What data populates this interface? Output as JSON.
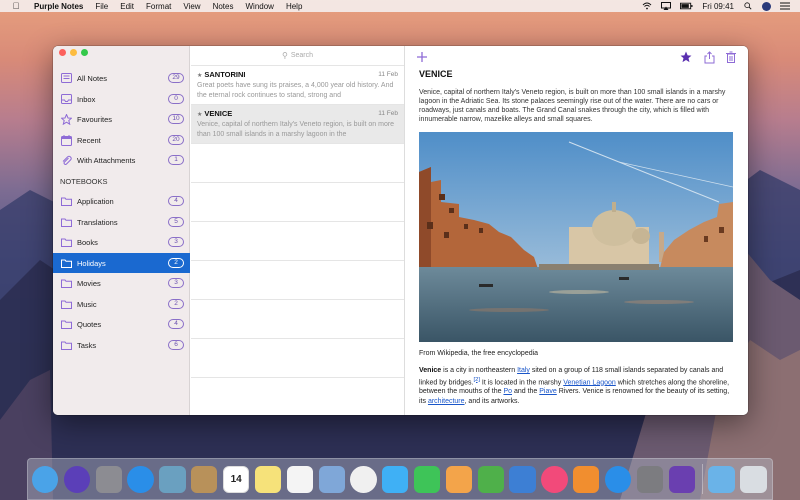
{
  "menubar": {
    "app_name": "Purple Notes",
    "items": [
      "File",
      "Edit",
      "Format",
      "View",
      "Notes",
      "Window",
      "Help"
    ],
    "clock": "Fri 09:41"
  },
  "sidebar": {
    "items": [
      {
        "label": "All Notes",
        "count": "29",
        "icon": "notes-icon"
      },
      {
        "label": "Inbox",
        "count": "0",
        "icon": "inbox-icon"
      },
      {
        "label": "Favourites",
        "count": "10",
        "icon": "star-icon"
      },
      {
        "label": "Recent",
        "count": "20",
        "icon": "calendar-icon"
      },
      {
        "label": "With Attachments",
        "count": "1",
        "icon": "paperclip-icon"
      }
    ],
    "notebooks_header": "NOTEBOOKS",
    "notebooks": [
      {
        "label": "Application",
        "count": "4"
      },
      {
        "label": "Translations",
        "count": "5"
      },
      {
        "label": "Books",
        "count": "3"
      },
      {
        "label": "Holidays",
        "count": "2",
        "selected": true
      },
      {
        "label": "Movies",
        "count": "3"
      },
      {
        "label": "Music",
        "count": "2"
      },
      {
        "label": "Quotes",
        "count": "4"
      },
      {
        "label": "Tasks",
        "count": "6"
      }
    ]
  },
  "list": {
    "search_placeholder": "Search",
    "notes": [
      {
        "title": "SANTORINI",
        "date": "11 Feb",
        "preview": "Great poets have sung its praises, a 4,000 year old history. And the eternal rock continues to stand, strong and"
      },
      {
        "title": "VENICE",
        "date": "11 Feb",
        "preview": "Venice, capital of northern Italy's Veneto region, is built on more than 100 small islands in a marshy lagoon in the"
      }
    ]
  },
  "content": {
    "title": "VENICE",
    "intro": "Venice, capital of northern Italy's Veneto region, is built on more than 100 small islands in a marshy lagoon in the Adriatic Sea. Its stone palaces seemingly rise out of the water. There are no cars or roadways, just canals and boats. The Grand Canal snakes through the city, which is filled with innumerable narrow, mazelike alleys and small squares.",
    "caption": "From Wikipedia, the free encyclopedia",
    "body": {
      "b_venice": "Venice",
      "t1": " is a city in northeastern ",
      "a_italy": "Italy",
      "t2": " sited on a group of 118 small islands separated by canals and linked by bridges.",
      "ref": "[2]",
      "t3": " It is located in the marshy ",
      "a_lagoon": "Venetian Lagoon",
      "t4": " which stretches along the shoreline, between the mouths of the ",
      "a_po": "Po",
      "t5": " and the ",
      "a_piave": "Piave",
      "t6": " Rivers. Venice is renowned for the beauty of its setting, its ",
      "a_arch": "architecture",
      "t7": ", and its artworks."
    }
  },
  "calendar_day": "14",
  "dock": [
    {
      "name": "finder",
      "color": "#4aa3e8"
    },
    {
      "name": "siri",
      "color": "#5b3fb8"
    },
    {
      "name": "launchpad",
      "color": "#8c8c92"
    },
    {
      "name": "safari",
      "color": "#2a8ee8"
    },
    {
      "name": "preview-photos",
      "color": "#6aa0c0"
    },
    {
      "name": "contacts",
      "color": "#b8915a"
    },
    {
      "name": "calendar",
      "color": "#ffffff"
    },
    {
      "name": "notes",
      "color": "#f6e27a"
    },
    {
      "name": "reminders",
      "color": "#f4f4f4"
    },
    {
      "name": "keynote-presentation",
      "color": "#7fa7d8"
    },
    {
      "name": "photos",
      "color": "#f0f0f0"
    },
    {
      "name": "messages",
      "color": "#3fb0f5"
    },
    {
      "name": "facetime",
      "color": "#3ec458"
    },
    {
      "name": "pages",
      "color": "#f3a44a"
    },
    {
      "name": "numbers",
      "color": "#4fb04a"
    },
    {
      "name": "keynote",
      "color": "#3d7fd4"
    },
    {
      "name": "itunes",
      "color": "#f24a7a"
    },
    {
      "name": "ibooks",
      "color": "#f18e2f"
    },
    {
      "name": "app-store",
      "color": "#2a8ee8"
    },
    {
      "name": "system-preferences",
      "color": "#7c7c80"
    },
    {
      "name": "purple-notes",
      "color": "#6a3fb0"
    },
    {
      "name": "downloads-folder",
      "color": "#6ab3e8"
    },
    {
      "name": "trash",
      "color": "#d9dde2"
    }
  ]
}
